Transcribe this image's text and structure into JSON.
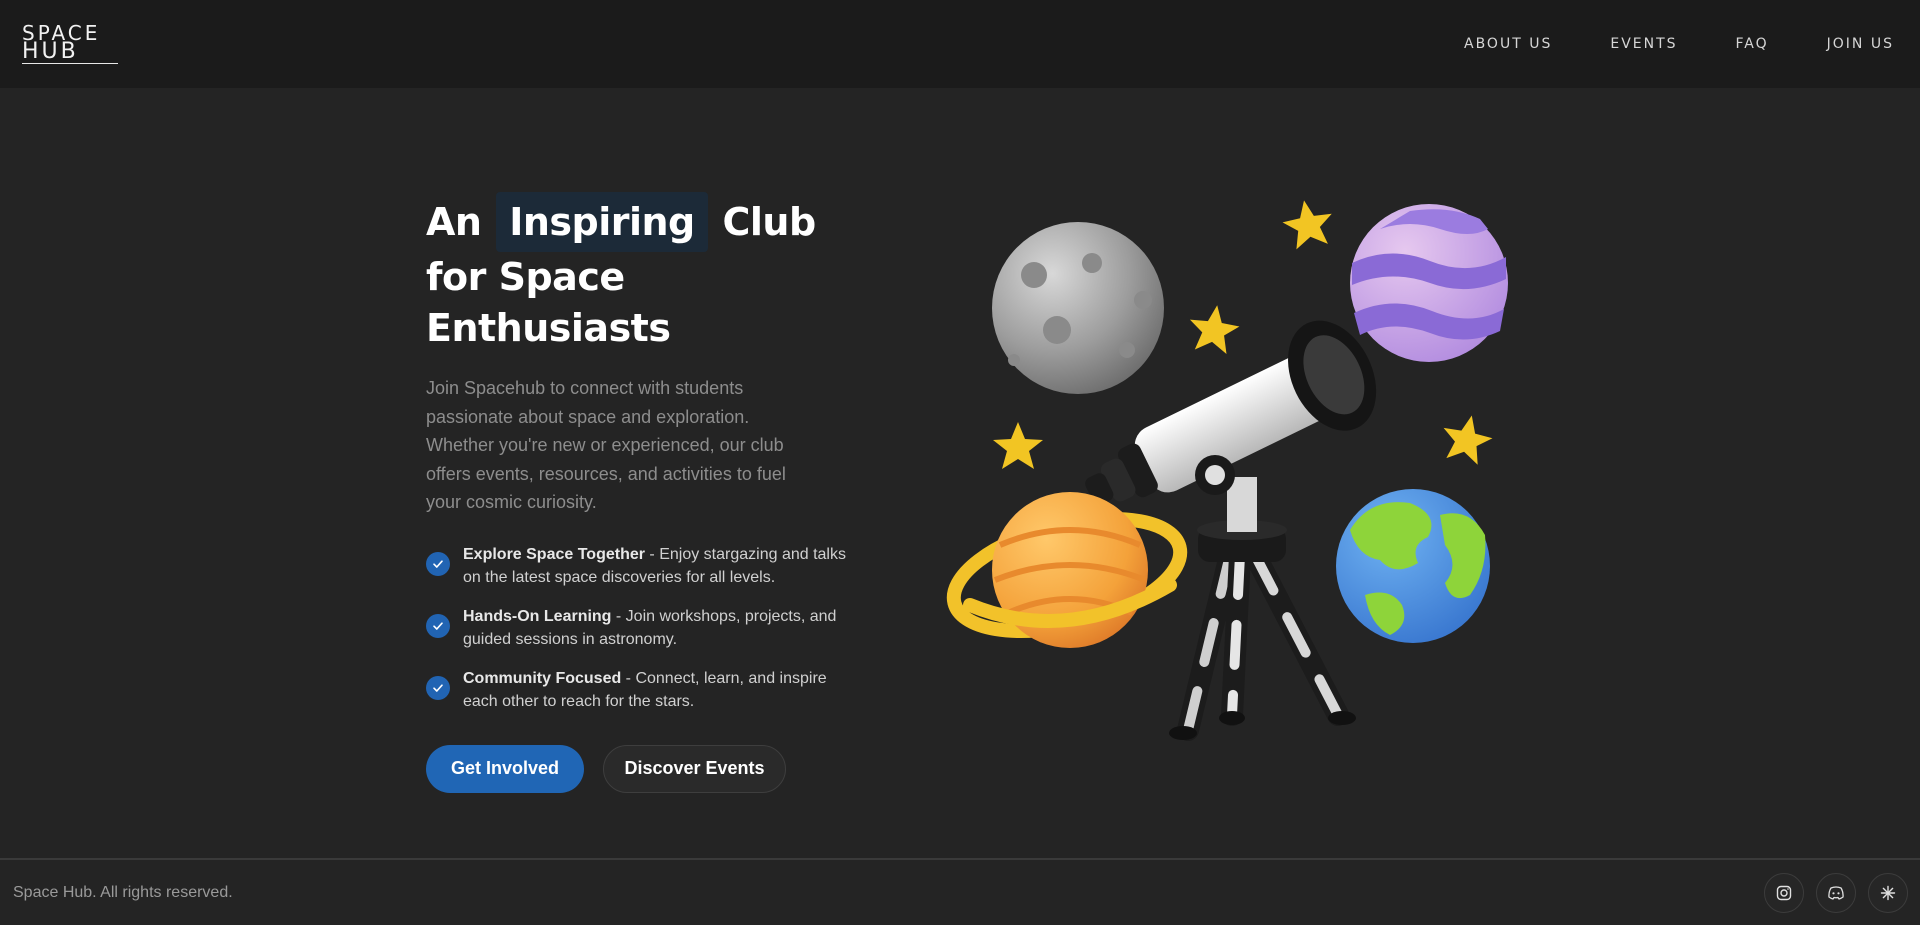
{
  "header": {
    "logo_line1": "SPACE",
    "logo_line2": "HUB",
    "nav": [
      {
        "label": "ABOUT US"
      },
      {
        "label": "EVENTS"
      },
      {
        "label": "FAQ"
      },
      {
        "label": "JOIN US"
      }
    ]
  },
  "hero": {
    "headline_pre": "An",
    "headline_highlight": "Inspiring",
    "headline_post": "Club",
    "headline_line2": "for Space Enthusiasts",
    "description": "Join Spacehub to connect with students passionate about space and exploration. Whether you're new or experienced, our club offers events, resources, and activities to fuel your cosmic curiosity.",
    "features": [
      {
        "title": "Explore Space Together",
        "text": " - Enjoy stargazing and talks on the latest space discoveries for all levels."
      },
      {
        "title": "Hands-On Learning",
        "text": " - Join workshops, projects, and guided sessions in astronomy."
      },
      {
        "title": "Community Focused",
        "text": " - Connect, learn, and inspire each other to reach for the stars."
      }
    ],
    "primary_button": "Get Involved",
    "secondary_button": "Discover Events"
  },
  "footer": {
    "copyright": "Space Hub. All rights reserved.",
    "socials": [
      "instagram-icon",
      "discord-icon",
      "spark-icon"
    ]
  },
  "colors": {
    "background": "#242424",
    "header_bg": "#1b1b1b",
    "accent_blue": "#2066b5",
    "highlight_bg": "#1c2a38"
  }
}
